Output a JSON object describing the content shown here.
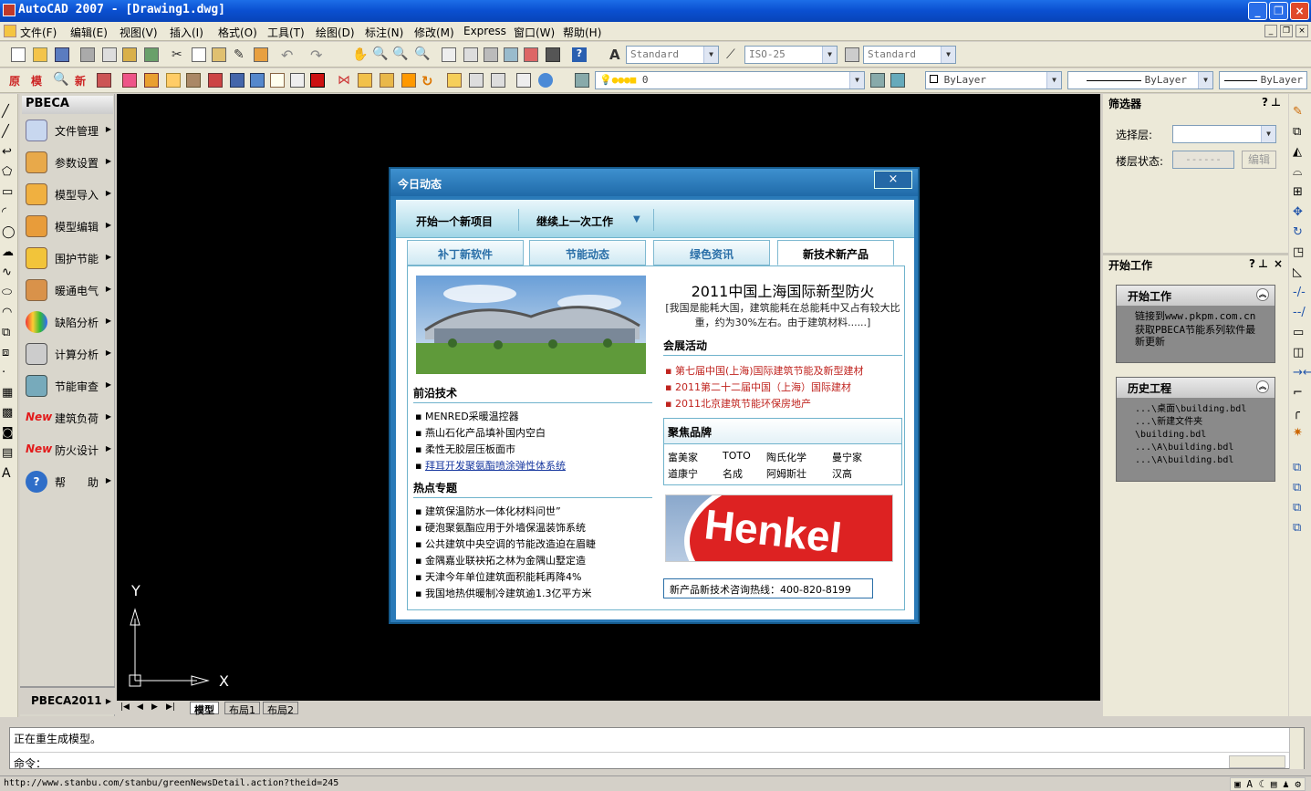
{
  "window": {
    "title": "AutoCAD 2007 - [Drawing1.dwg]"
  },
  "menu": [
    "文件(F)",
    "编辑(E)",
    "视图(V)",
    "插入(I)",
    "格式(O)",
    "工具(T)",
    "绘图(D)",
    "标注(N)",
    "修改(M)",
    "Express",
    "窗口(W)",
    "帮助(H)"
  ],
  "toolbar": {
    "text_style": "Standard",
    "dim_style": "ISO-25",
    "table_style": "Standard",
    "layer": "0",
    "color": "ByLayer",
    "linetype": "ByLayer",
    "lineweight": "ByLayer"
  },
  "pbeca": {
    "header": "PBECA",
    "items": [
      "文件管理",
      "参数设置",
      "模型导入",
      "模型编辑",
      "围护节能",
      "暖通电气",
      "缺陷分析",
      "计算分析",
      "节能审查",
      "建筑负荷",
      "防火设计",
      "帮　　助"
    ],
    "new_label": "New",
    "footer": "PBECA2011"
  },
  "layout_tabs": [
    "模型",
    "布局1",
    "布局2"
  ],
  "axes": {
    "x": "X",
    "y": "Y"
  },
  "filter_panel": {
    "title": "筛选器",
    "layer_label": "选择层:",
    "floor_label": "楼层状态:",
    "floor_value": "------",
    "edit_btn": "编辑"
  },
  "start_panel": {
    "title": "开始工作",
    "group1_title": "开始工作",
    "group1_line1": "链接到www.pkpm.com.cn",
    "group1_line2": "获取PBECA节能系列软件最新更新",
    "group2_title": "历史工程",
    "history": [
      "...\\桌面\\building.bdl",
      "...\\新建文件夹\\building.bdl",
      "...\\A\\building.bdl",
      "...\\A\\building.bdl"
    ]
  },
  "dialog": {
    "title": "今日动态",
    "close": "×",
    "start_new": "开始一个新项目",
    "continue_last": "继续上一次工作",
    "tabs": [
      "补丁新软件",
      "节能动态",
      "绿色资讯",
      "新技术新产品"
    ],
    "headline": "2011中国上海国际新型防火",
    "headline_sub": "[我国是能耗大国，建筑能耗在总能耗中又占有较大比重，约为30%左右。由于建筑材料......]",
    "frontier_title": "前沿技术",
    "frontier": [
      "MENRED采暖温控器",
      "燕山石化产品填补国内空白",
      "柔性无胶层压板面市",
      "拜耳开发聚氨酯喷涂弹性体系统"
    ],
    "hot_title": "热点专题",
    "hot": [
      "建筑保温防水一体化材料问世”",
      "硬泡聚氨酯应用于外墙保温装饰系统",
      "公共建筑中央空调的节能改造迫在眉睫",
      "金隅嘉业联袂拓之林为金隅山墅定造",
      "天津今年单位建筑面积能耗再降4%",
      "我国地热供暖制冷建筑逾1.3亿平方米"
    ],
    "expo_title": "会展活动",
    "expo": [
      "第七届中国(上海)国际建筑节能及新型建材",
      "2011第二十二届中国（上海）国际建材",
      "2011北京建筑节能环保房地产"
    ],
    "brand_title": "聚焦品牌",
    "brands": [
      "富美家",
      "TOTO",
      "陶氏化学",
      "曼宁家",
      "道康宁",
      "名成",
      "阿姆斯壮",
      "汉高"
    ],
    "ad_text": "Henkel",
    "hotline": "新产品新技术咨询热线：400-820-8199"
  },
  "command": {
    "line1": "正在重生成模型。",
    "prompt": "命令："
  },
  "status_url": "http://www.stanbu.com/stanbu/greenNewsDetail.action?theid=245",
  "colors": {
    "canvas": "#000000",
    "dialog_frame": "#2a7ab8",
    "red_text": "#c0241f"
  }
}
